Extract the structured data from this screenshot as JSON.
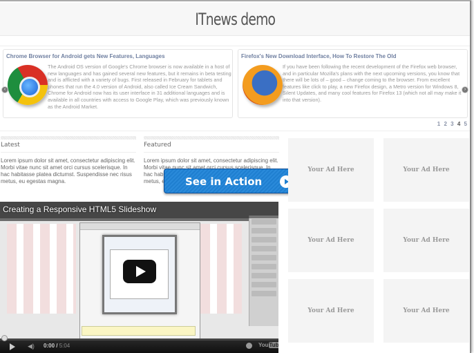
{
  "header": {
    "title": "ITnews demo"
  },
  "slider": {
    "slides": [
      {
        "title": "Chrome Browser for Android gets New Features, Languages",
        "image_icon": "chrome-logo",
        "text": "The Android OS version of Google's Chrome browser is now available in a host of new languages and has gained several new features, but it remains in beta testing and is afflicted with a variety of bugs. First released in February for tablets and phones that run the 4.0 version of Android, also called Ice Cream Sandwich, Chrome for Android now has its user interface in 31 additional languages and is available in all countries with access to Google Play, which was previously known as the Android Market."
      },
      {
        "title": "Firefox's New Download Interface, How To Restore The Old",
        "image_icon": "firefox-logo",
        "text": "If you have been following the recent development of the Firefox web browser, and in particular Mozilla's plans with the next upcoming versions, you know that there will be lots of – good – change coming to the browser. From excellent features like click to play, a new Firefox design, a Metro version for Windows 8, Silent Updates, and many cool features for Firefox 13 (which not all may make it into that version)."
      }
    ],
    "prev_icon": "‹",
    "next_icon": "›",
    "pages": [
      "1",
      "2",
      "3",
      "4",
      "5"
    ],
    "active_page": "4"
  },
  "columns": {
    "latest": {
      "title": "Latest",
      "text": "Lorem ipsum dolor sit amet, consectetur adipiscing elit. Morbi vitae nunc sit amet orci cursus scelerisque. In hac habitasse platea dictumst. Suspendisse nec risus metus, eu egestas magna."
    },
    "featured": {
      "title": "Featured",
      "text": "Lorem ipsum dolor sit amet, consectetur adipiscing elit. Morbi vitae nunc sit amet orci cursus scelerisque. In hac habitasse platea dictumst. Suspendisse nec risus metus, eu egestas magna."
    }
  },
  "cta": {
    "label": "See in Action",
    "color": "#1f7fd0"
  },
  "video": {
    "title": "Creating a Responsive HTML5 Slideshow",
    "time_current": "0:00",
    "time_duration": "5:04",
    "brand": "YouTube",
    "brand_parts": [
      "You",
      "Tube"
    ]
  },
  "ads": [
    "Your Ad Here",
    "Your Ad Here",
    "Your Ad Here",
    "Your Ad Here",
    "Your Ad Here",
    "Your Ad Here"
  ]
}
